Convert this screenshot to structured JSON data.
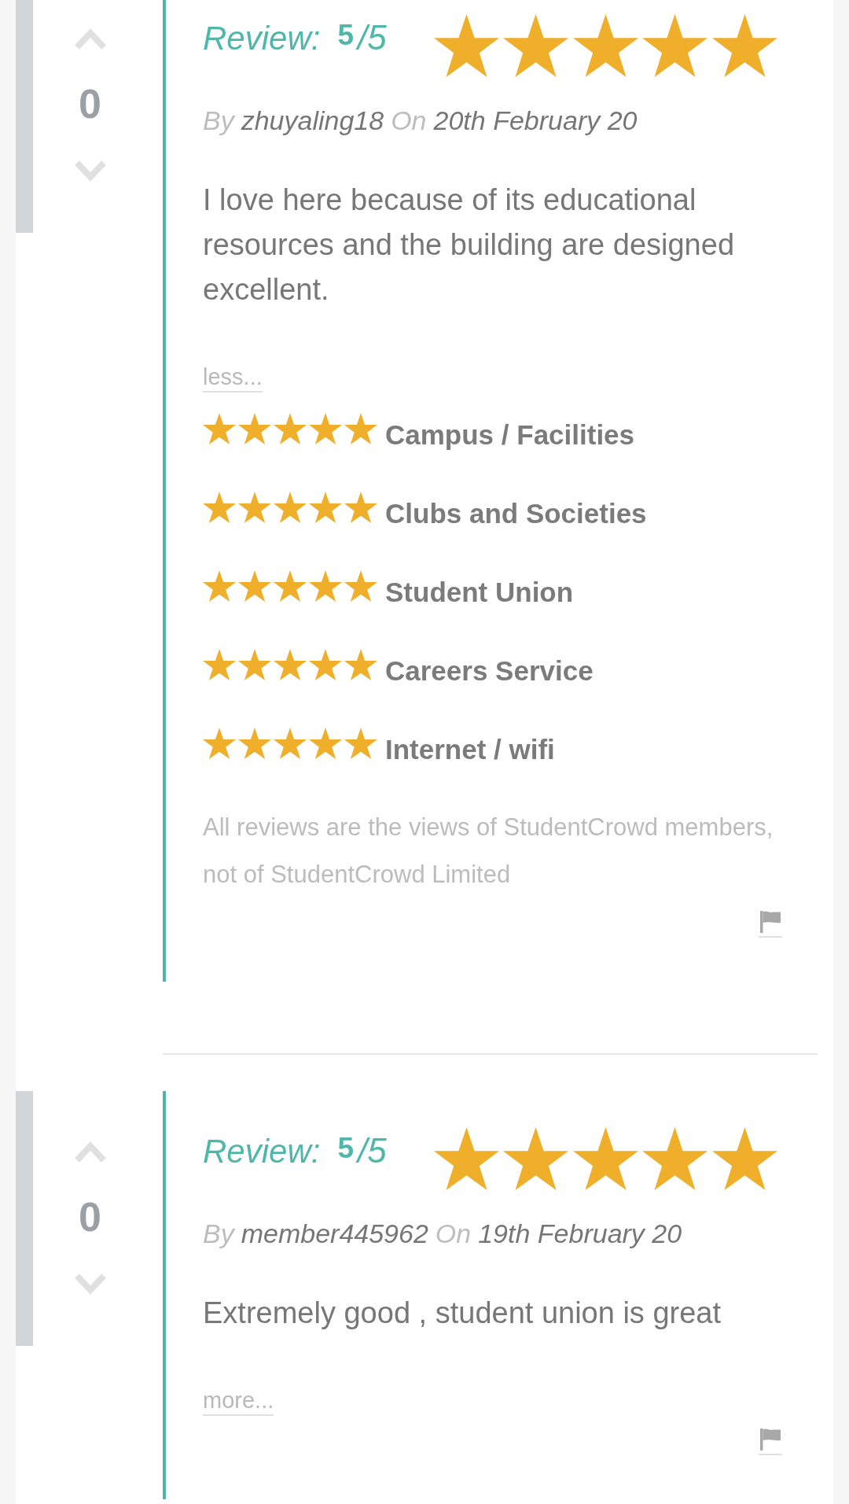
{
  "reviews": [
    {
      "votes": "0",
      "heading": "Review:",
      "score": "5",
      "scale": "/5",
      "stars": 5,
      "by_label": "By",
      "author": "zhuyaling18",
      "on_label": "On",
      "date": "20th February 20",
      "body": "I love here because of its educational resources and the building are designed excellent.",
      "toggle": "less...",
      "categories": [
        {
          "label": "Campus / Facilities",
          "stars": 5
        },
        {
          "label": "Clubs and Societies",
          "stars": 5
        },
        {
          "label": "Student Union",
          "stars": 5
        },
        {
          "label": "Careers Service",
          "stars": 5
        },
        {
          "label": "Internet / wifi",
          "stars": 5
        }
      ],
      "disclaimer": "All reviews are the views of StudentCrowd members, not of StudentCrowd Limited"
    },
    {
      "votes": "0",
      "heading": "Review:",
      "score": "5",
      "scale": "/5",
      "stars": 5,
      "by_label": "By",
      "author": "member445962",
      "on_label": "On",
      "date": "19th February 20",
      "body": "Extremely good , student union is great",
      "toggle": "more..."
    }
  ]
}
